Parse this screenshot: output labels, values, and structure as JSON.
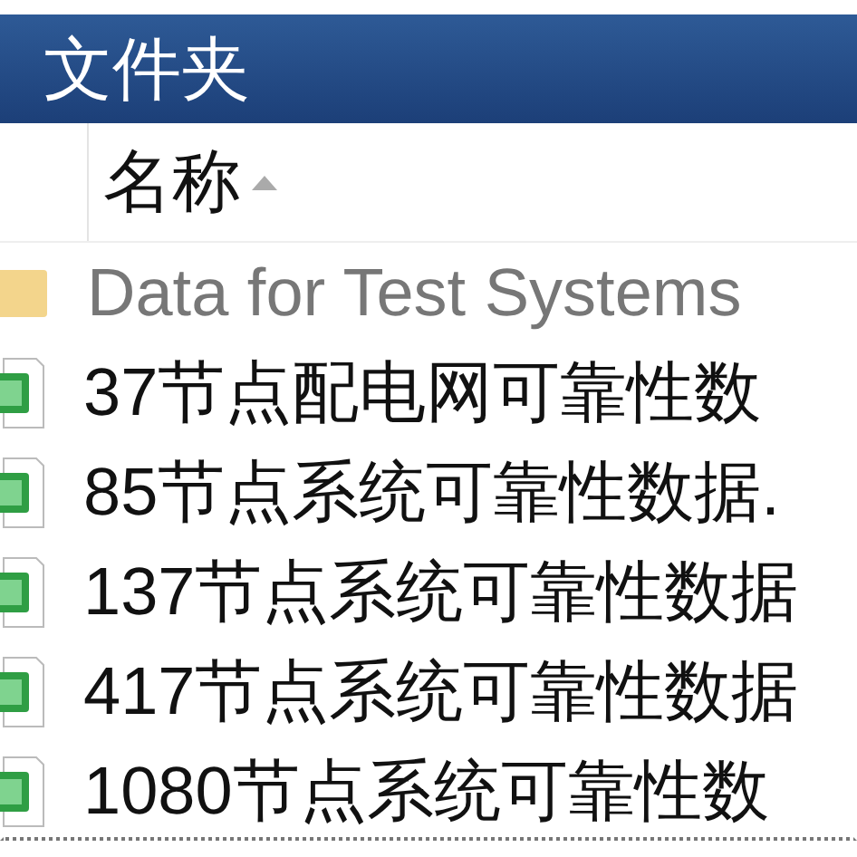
{
  "window": {
    "title": "文件夹"
  },
  "column_header": {
    "label": "名称",
    "sorted": true
  },
  "items": [
    {
      "kind": "folder",
      "name": "Data for Test Systems",
      "focused": false
    },
    {
      "kind": "spreadsheet",
      "name": "37节点配电网可靠性数",
      "focused": false
    },
    {
      "kind": "spreadsheet",
      "name": "85节点系统可靠性数据.",
      "focused": false
    },
    {
      "kind": "spreadsheet",
      "name": "137节点系统可靠性数据",
      "focused": false
    },
    {
      "kind": "spreadsheet",
      "name": "417节点系统可靠性数据",
      "focused": false
    },
    {
      "kind": "spreadsheet",
      "name": "1080节点系统可靠性数",
      "focused": true
    }
  ]
}
